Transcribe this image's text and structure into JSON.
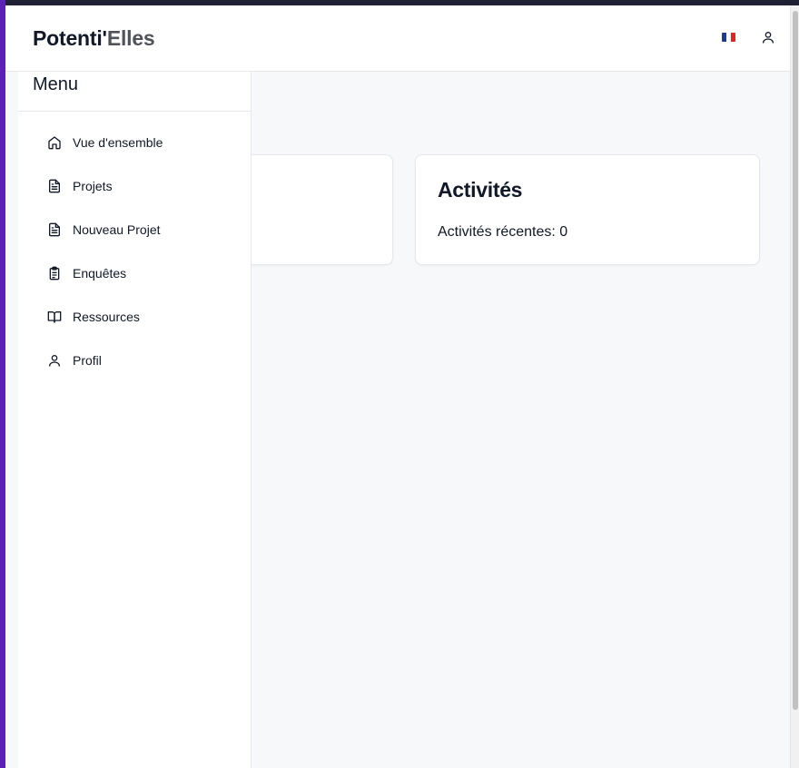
{
  "header": {
    "brand_part1": "Potenti'",
    "brand_part2": "Elles",
    "language_flag": "fr-flag",
    "user_icon": "user-icon"
  },
  "sidebar": {
    "title": "Menu",
    "items": [
      {
        "label": "Vue d'ensemble",
        "icon": "home-icon"
      },
      {
        "label": "Projets",
        "icon": "file-text-icon"
      },
      {
        "label": "Nouveau Projet",
        "icon": "file-text-icon"
      },
      {
        "label": "Enquêtes",
        "icon": "clipboard-list-icon"
      },
      {
        "label": "Ressources",
        "icon": "book-open-icon"
      },
      {
        "label": "Profil",
        "icon": "user-icon"
      }
    ]
  },
  "cards": {
    "activities": {
      "title": "Activités",
      "body": "Activités récentes: 0"
    }
  },
  "colors": {
    "text": "#111827",
    "brand_secondary": "#52525b",
    "background": "#f7f8fa",
    "border": "#e5e7eb",
    "flag_blue": "#1e3a8a",
    "flag_white": "#ffffff",
    "flag_red": "#dc2626"
  }
}
